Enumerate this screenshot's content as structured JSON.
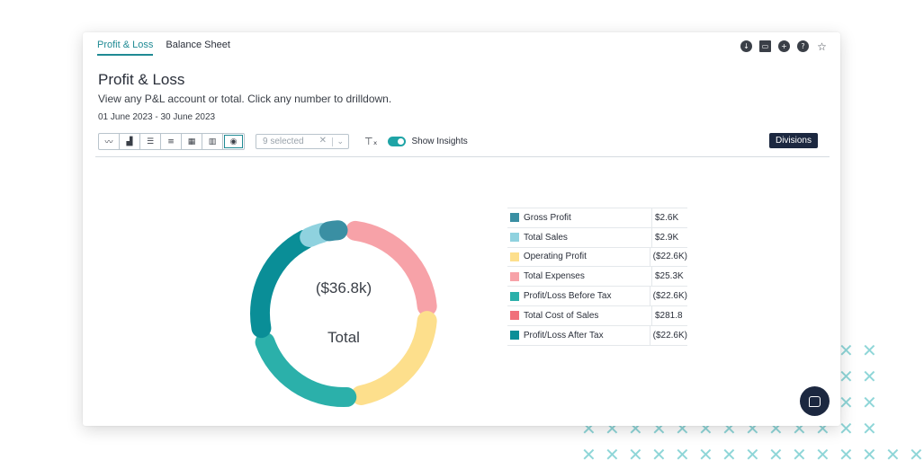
{
  "tabs": [
    {
      "label": "Profit & Loss",
      "active": true
    },
    {
      "label": "Balance Sheet",
      "active": false
    }
  ],
  "top_icons": [
    "download-icon",
    "presentation-icon",
    "add-circle-icon",
    "help-icon",
    "star-icon"
  ],
  "header": {
    "title": "Profit & Loss",
    "subtitle": "View any P&L account or total. Click any number to drilldown.",
    "date_range": "01 June 2023 - 30 June 2023"
  },
  "toolbar": {
    "chart_types": [
      "line-chart-icon",
      "bar-chart-icon",
      "horizontal-bar-icon",
      "sorted-bar-icon",
      "grid-icon",
      "table-icon",
      "donut-icon"
    ],
    "active_chart_type": "donut-icon",
    "select": {
      "value": "9 selected"
    },
    "show_insights_label": "Show Insights",
    "show_insights_on": true,
    "divisions_label": "Divisions"
  },
  "chart_data": {
    "type": "pie",
    "center_value": "($36.8k)",
    "center_label": "Total",
    "slices": [
      {
        "name": "Gross Profit",
        "value": "$2.6K",
        "color": "#3a8fa3"
      },
      {
        "name": "Total Sales",
        "value": "$2.9K",
        "color": "#8fd2df"
      },
      {
        "name": "Operating Profit",
        "value": "($22.6K)",
        "color": "#fddf8c"
      },
      {
        "name": "Total Expenses",
        "value": "$25.3K",
        "color": "#f7a2a8"
      },
      {
        "name": "Profit/Loss Before Tax",
        "value": "($22.6K)",
        "color": "#2bb0aa"
      },
      {
        "name": "Total Cost of Sales",
        "value": "$281.8",
        "color": "#f0707a"
      },
      {
        "name": "Profit/Loss After Tax",
        "value": "($22.6K)",
        "color": "#0a8e97"
      }
    ]
  }
}
